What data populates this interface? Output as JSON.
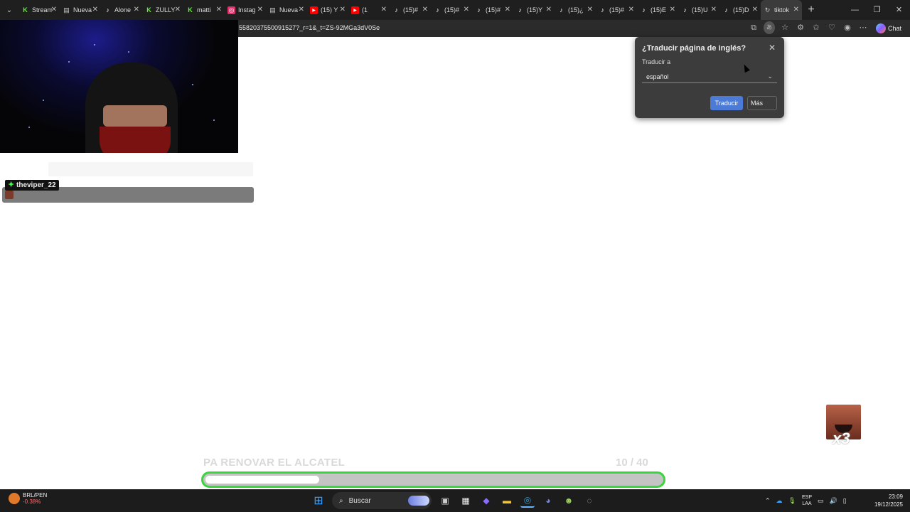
{
  "browser": {
    "tabs": [
      {
        "label": "Stream",
        "icon": "kick-icon",
        "color": "#53fc18"
      },
      {
        "label": "Nueva",
        "icon": "page-icon",
        "color": "#cccccc"
      },
      {
        "label": "Alone",
        "icon": "tiktok-icon",
        "color": "#ffffff"
      },
      {
        "label": "ZULLY",
        "icon": "kick-icon",
        "color": "#53fc18"
      },
      {
        "label": "matti",
        "icon": "kick-icon",
        "color": "#53fc18"
      },
      {
        "label": "Instag",
        "icon": "instagram-icon",
        "color": "#e1306c"
      },
      {
        "label": "Nueva",
        "icon": "page-icon",
        "color": "#cccccc"
      },
      {
        "label": "(15) Y",
        "icon": "youtube-icon",
        "color": "#ff0000"
      },
      {
        "label": "(1",
        "icon": "youtube-icon",
        "color": "#ff0000"
      },
      {
        "label": "(15)#",
        "icon": "tiktok-icon",
        "color": "#ffffff"
      },
      {
        "label": "(15)#",
        "icon": "tiktok-icon",
        "color": "#ffffff"
      },
      {
        "label": "(15)#",
        "icon": "tiktok-icon",
        "color": "#ffffff"
      },
      {
        "label": "(15)Y",
        "icon": "tiktok-icon",
        "color": "#ffffff"
      },
      {
        "label": "(15)¿",
        "icon": "tiktok-icon",
        "color": "#ffffff"
      },
      {
        "label": "(15)#",
        "icon": "tiktok-icon",
        "color": "#ffffff"
      },
      {
        "label": "(15)E",
        "icon": "tiktok-icon",
        "color": "#ffffff"
      },
      {
        "label": "(15)U",
        "icon": "tiktok-icon",
        "color": "#ffffff"
      },
      {
        "label": "(15)D",
        "icon": "tiktok-icon",
        "color": "#ffffff"
      },
      {
        "label": "tiktok",
        "icon": "loading-icon",
        "color": "#cccccc"
      }
    ],
    "url": "55820375500915​27?_r=1&_t=ZS-92MGa3dV0Se",
    "chat_label": "Chat"
  },
  "overlay": {
    "username": "theviper_22"
  },
  "translate_popup": {
    "title": "¿Traducir página de inglés?",
    "translate_to_label": "Traducir a",
    "language_value": "español",
    "translate_button": "Traducir",
    "more_button": "Más"
  },
  "goal": {
    "text": "PA RENOVAR EL ALCATEL",
    "current": 10,
    "total": 40,
    "count_text": "10  / 40",
    "accent": "#39d53c"
  },
  "gift": {
    "count": "x3"
  },
  "taskbar": {
    "ticker_name": "BRL/PEN",
    "ticker_change": "-0.38%",
    "search_placeholder": "Buscar",
    "lang_top": "ESP",
    "lang_bottom": "LAA",
    "time": "23:09",
    "date": "19/12/2025"
  }
}
